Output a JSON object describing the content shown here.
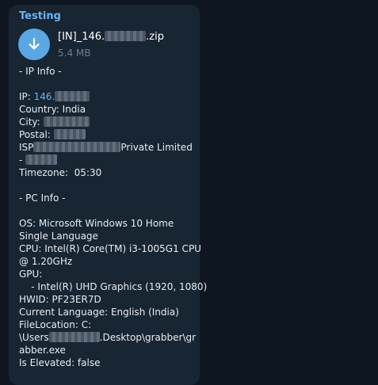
{
  "message": {
    "sender": "Testing",
    "file": {
      "name_prefix": "[IN]_146.",
      "name_suffix": ".zip",
      "size": "5.4 MB"
    },
    "lines": [
      {
        "text": "- IP Info -"
      },
      {
        "text": ""
      },
      {
        "text": "IP: ",
        "link": "146.",
        "blur": 44
      },
      {
        "text": "Country: India"
      },
      {
        "text": "City: ",
        "blur": 58
      },
      {
        "text": "Postal: ",
        "blur": 40
      },
      {
        "text": "ISP",
        "blur": 110,
        "after": "Private Limited"
      },
      {
        "text": "- ",
        "blur": 40
      },
      {
        "text": "Timezone:  05:30"
      },
      {
        "text": ""
      },
      {
        "text": "- PC Info -"
      },
      {
        "text": ""
      },
      {
        "text": "OS: Microsoft Windows 10 Home"
      },
      {
        "text": "Single Language"
      },
      {
        "text": "CPU: Intel(R) Core(TM) i3-1005G1 CPU"
      },
      {
        "text": "@ 1.20GHz"
      },
      {
        "text": "GPU:"
      },
      {
        "text": "    - Intel(R) UHD Graphics (1920, 1080)"
      },
      {
        "text": "HWID: PF23ER7D"
      },
      {
        "text": "Current Language: English (India)"
      },
      {
        "text": "FileLocation: C:"
      },
      {
        "text": "\\Users",
        "blur": 64,
        "after": ".Desktop\\grabber\\gr"
      },
      {
        "text": "abber.exe"
      },
      {
        "text": "Is Elevated: false"
      }
    ]
  },
  "icons": {
    "download": "download-arrow-icon"
  }
}
